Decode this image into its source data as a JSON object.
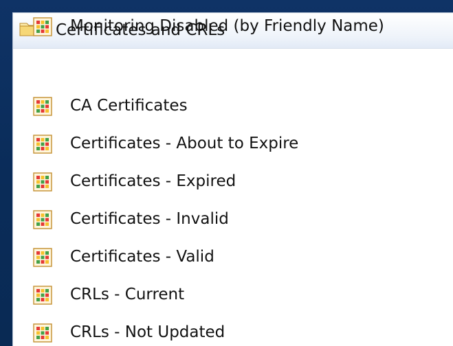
{
  "tree": {
    "root": {
      "label": "Certificates and CRLs",
      "icon": "folder-lock-icon"
    },
    "items": [
      {
        "label": "CA Certificates",
        "icon": "grid-status-icon"
      },
      {
        "label": "Certificates - About to Expire",
        "icon": "grid-status-icon"
      },
      {
        "label": "Certificates - Expired",
        "icon": "grid-status-icon"
      },
      {
        "label": "Certificates - Invalid",
        "icon": "grid-status-icon"
      },
      {
        "label": "Certificates - Valid",
        "icon": "grid-status-icon"
      },
      {
        "label": "CRLs - Current",
        "icon": "grid-status-icon"
      },
      {
        "label": "CRLs - Not Updated",
        "icon": "grid-status-icon"
      },
      {
        "label": "Monitoring Disabled (by Friendly Name)",
        "icon": "grid-status-icon"
      }
    ]
  },
  "colors": {
    "background": "#0b2a57",
    "panel": "#ffffff",
    "header_gradient_top": "#ffffff",
    "header_gradient_bottom": "#e2eaf6",
    "icon_red": "#e53935",
    "icon_yellow": "#f6c12d",
    "icon_green": "#43a047"
  }
}
